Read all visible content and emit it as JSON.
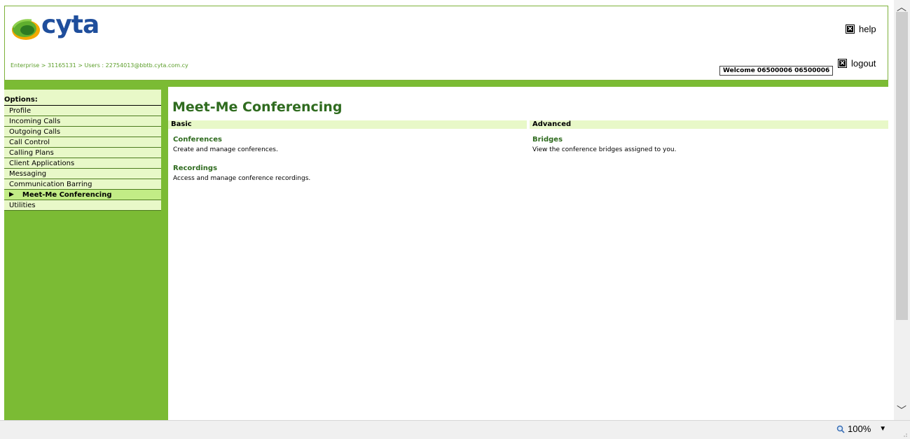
{
  "header": {
    "logo_text": "cyta",
    "breadcrumb": {
      "enterprise": "Enterprise",
      "sep1": " > ",
      "enterprise_id": "31165131",
      "sep2": " > ",
      "users": "Users",
      "sep3": " : ",
      "user": "22754013@bbtb.cyta.com.cy"
    },
    "help_label": "help",
    "logout_label": "logout",
    "welcome": "Welcome 06500006 06500006"
  },
  "sidebar": {
    "title": "Options:",
    "items": [
      {
        "label": "Profile"
      },
      {
        "label": "Incoming Calls"
      },
      {
        "label": "Outgoing Calls"
      },
      {
        "label": "Call Control"
      },
      {
        "label": "Calling Plans"
      },
      {
        "label": "Client Applications"
      },
      {
        "label": "Messaging"
      },
      {
        "label": "Communication Barring"
      },
      {
        "label": "Meet-Me Conferencing",
        "active": true
      },
      {
        "label": "Utilities"
      }
    ]
  },
  "main": {
    "title": "Meet-Me Conferencing",
    "basic": {
      "header": "Basic",
      "items": [
        {
          "title": "Conferences",
          "desc": "Create and manage conferences."
        },
        {
          "title": "Recordings",
          "desc": "Access and manage conference recordings."
        }
      ]
    },
    "advanced": {
      "header": "Advanced",
      "items": [
        {
          "title": "Bridges",
          "desc": "View the conference bridges assigned to you."
        }
      ]
    }
  },
  "statusbar": {
    "zoom": "100%"
  },
  "colors": {
    "brand_green": "#7bbb34",
    "title_green": "#2f6b1f",
    "light_green": "#e8f8c8",
    "logo_blue": "#1f4e9c"
  }
}
